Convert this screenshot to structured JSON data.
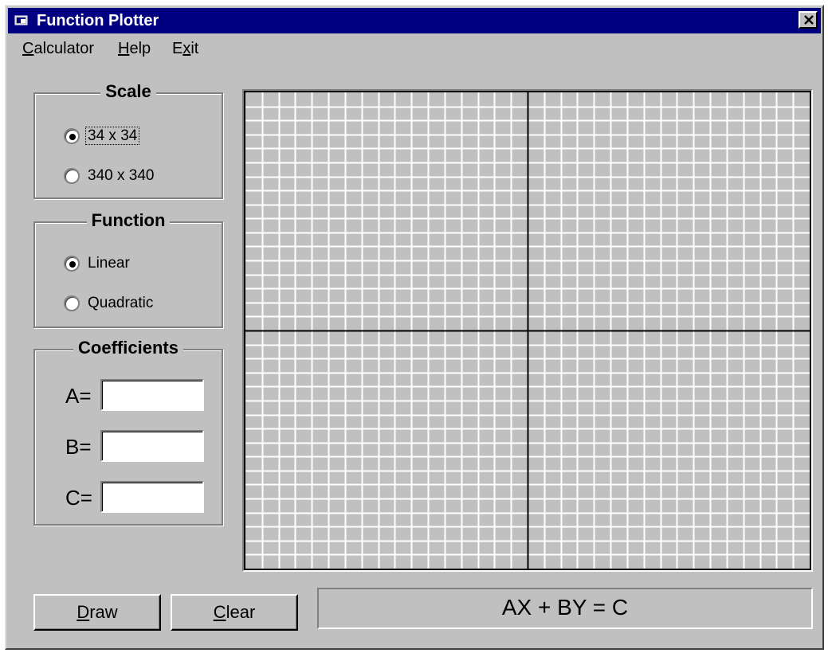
{
  "window": {
    "title": "Function Plotter",
    "icon": "app-window-icon",
    "close_icon": "close-icon"
  },
  "menu": {
    "items": [
      {
        "label_pre": "",
        "accel": "C",
        "label_post": "alculator"
      },
      {
        "label_pre": "",
        "accel": "H",
        "label_post": "elp"
      },
      {
        "label_pre": "E",
        "accel": "x",
        "label_post": "it"
      }
    ]
  },
  "scale": {
    "title": "Scale",
    "options": [
      "34 x 34",
      "340 x 340"
    ],
    "selected": "34 x 34"
  },
  "function": {
    "title": "Function",
    "options": [
      "Linear",
      "Quadratic"
    ],
    "selected": "Linear"
  },
  "coefficients": {
    "title": "Coefficients",
    "a_label": "A=",
    "b_label": "B=",
    "c_label": "C=",
    "a_value": "",
    "b_value": "",
    "c_value": ""
  },
  "plot": {
    "grid_divisions": 34,
    "grid_color": "#ffffff",
    "axis_color": "#000000",
    "background": "#c0c0c0"
  },
  "buttons": {
    "draw": {
      "accel": "D",
      "rest": "raw"
    },
    "clear": {
      "accel": "C",
      "rest": "lear"
    }
  },
  "equation": "AX + BY = C",
  "colors": {
    "titlebar": "#000080",
    "face": "#c0c0c0"
  }
}
